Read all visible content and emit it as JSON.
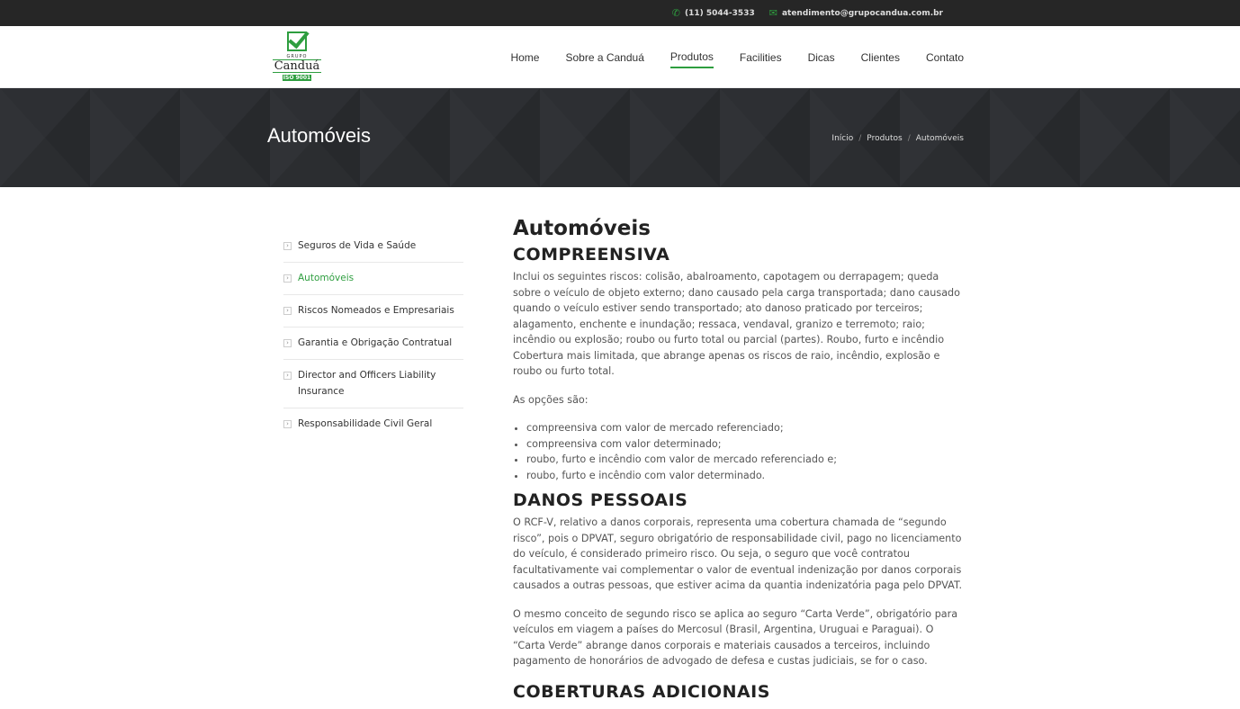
{
  "topbar": {
    "phone": "(11) 5044-3533",
    "email": "atendimento@grupocandua.com.br"
  },
  "logo": {
    "grupo": "GRUPO",
    "name": "Canduá",
    "iso": "ISO 9001"
  },
  "nav": {
    "items": [
      {
        "label": "Home"
      },
      {
        "label": "Sobre a Canduá"
      },
      {
        "label": "Produtos"
      },
      {
        "label": "Facilities"
      },
      {
        "label": "Dicas"
      },
      {
        "label": "Clientes"
      },
      {
        "label": "Contato"
      }
    ],
    "active": "Produtos"
  },
  "banner": {
    "title": "Automóveis",
    "breadcrumb": [
      "Início",
      "Produtos",
      "Automóveis"
    ]
  },
  "sidebar": {
    "items": [
      {
        "label": "Seguros de Vida e Saúde"
      },
      {
        "label": "Automóveis"
      },
      {
        "label": "Riscos Nomeados e Empresariais"
      },
      {
        "label": "Garantia e Obrigação Contratual"
      },
      {
        "label": "Director and Officers Liability Insurance"
      },
      {
        "label": "Responsabilidade Civil Geral"
      }
    ]
  },
  "content": {
    "title": "Automóveis",
    "h_compreensiva": "COMPREENSIVA",
    "p1": "Inclui os seguintes riscos: colisão, abalroamento, capotagem ou derrapagem; queda sobre o veículo de objeto externo; dano causado pela carga transportada; dano causado quando o veículo estiver sendo transportado; ato danoso praticado por terceiros; alagamento, enchente e inundação; ressaca, vendaval, granizo e terremoto; raio; incêndio ou explosão; roubo ou furto total ou parcial (partes). Roubo, furto e incêndio Cobertura mais limitada, que abrange apenas os riscos de raio, incêndio, explosão e roubo ou furto total.",
    "p2": "As opções são:",
    "options": [
      "compreensiva com valor de mercado referenciado;",
      "compreensiva com valor determinado;",
      "roubo, furto e incêndio com valor de mercado referenciado e;",
      "roubo, furto e incêndio com valor determinado."
    ],
    "h_danos": "DANOS PESSOAIS",
    "p3": "O RCF-V, relativo a danos corporais, representa uma cobertura chamada de “segundo risco”, pois o DPVAT, seguro obrigatório de responsabilidade civil, pago no licenciamento do veículo, é considerado primeiro risco. Ou seja, o seguro que você contratou facultativamente vai complementar o valor de eventual indenização por danos corporais causados a outras pessoas, que estiver acima da quantia indenizatória paga pelo DPVAT.",
    "p4": "O mesmo conceito de segundo risco se aplica ao seguro “Carta Verde”, obrigatório para veículos em viagem a países do Mercosul (Brasil, Argentina, Uruguai e Paraguai). O “Carta Verde” abrange danos corporais e materiais causados a terceiros, incluindo pagamento de honorários de advogado de defesa e custas judiciais, se for o caso.",
    "h_coberturas": "COBERTURAS ADICIONAIS"
  },
  "colors": {
    "accent": "#2e9e3f",
    "topbar": "#262626",
    "banner": "#2b2d30"
  }
}
